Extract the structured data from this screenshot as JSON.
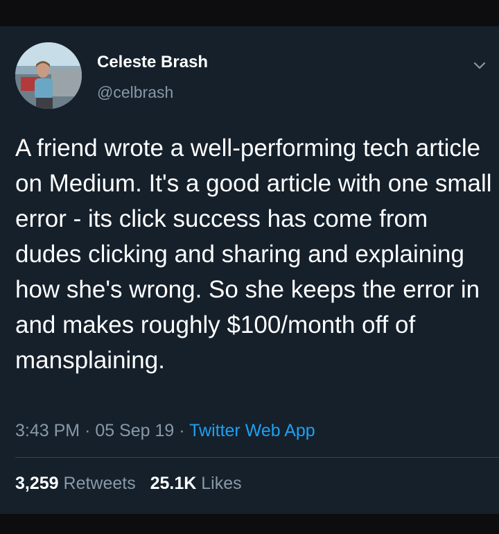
{
  "tweet": {
    "author_name": "Celeste Brash",
    "author_handle": "@celbrash",
    "text": "A friend wrote a well-performing tech article on Medium. It's a good article with one small error - its click success has come from dudes clicking and sharing and explaining how she's wrong. So she keeps the error in and makes roughly $100/month off of mansplaining.",
    "time": "3:43 PM",
    "separator": "·",
    "date": "05 Sep 19",
    "source": "Twitter Web App"
  },
  "stats": {
    "retweets_count": "3,259",
    "retweets_label": "Retweets",
    "likes_count": "25.1K",
    "likes_label": "Likes"
  },
  "colors": {
    "background": "#15202b",
    "text": "#ffffff",
    "secondary_text": "#8899a6",
    "link": "#1da1f2",
    "divider": "#38444d"
  },
  "icons": {
    "menu": "chevron-down-icon"
  }
}
